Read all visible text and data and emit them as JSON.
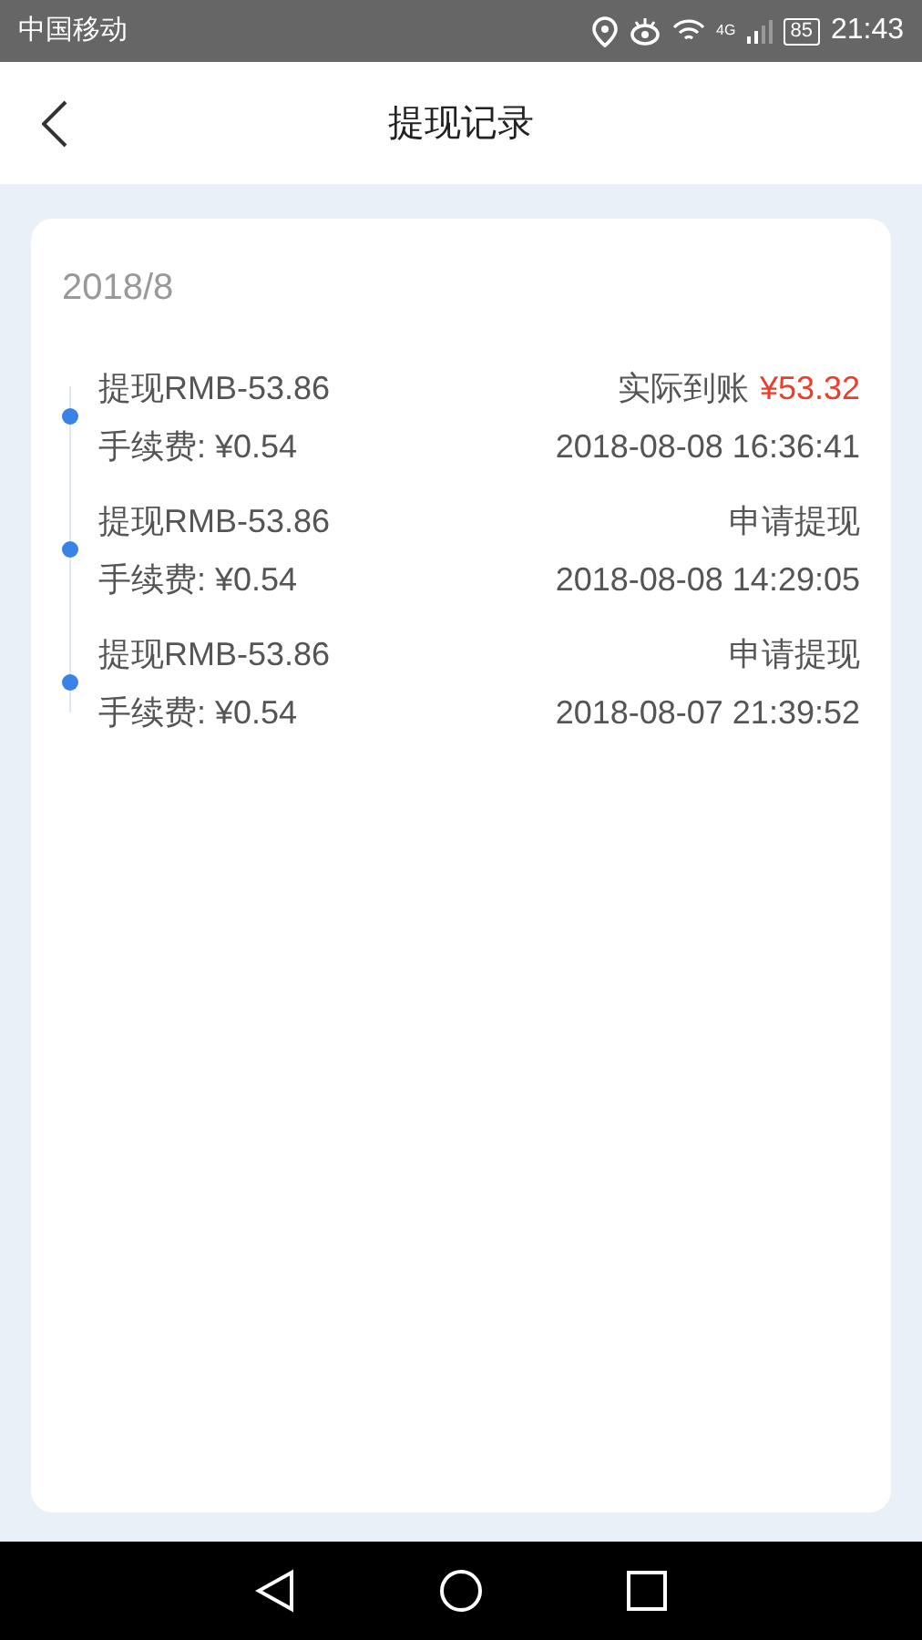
{
  "status_bar": {
    "carrier": "中国移动",
    "network": "4G",
    "battery": "85",
    "time": "21:43"
  },
  "header": {
    "title": "提现记录"
  },
  "records": {
    "month": "2018/8",
    "items": [
      {
        "amount": "提现RMB-53.86",
        "fee": "手续费: ¥0.54",
        "status": "实际到账",
        "received": "¥53.32",
        "time": "2018-08-08 16:36:41"
      },
      {
        "amount": "提现RMB-53.86",
        "fee": "手续费: ¥0.54",
        "status": "申请提现",
        "time": "2018-08-08 14:29:05"
      },
      {
        "amount": "提现RMB-53.86",
        "fee": "手续费: ¥0.54",
        "status": "申请提现",
        "time": "2018-08-07 21:39:52"
      }
    ]
  }
}
